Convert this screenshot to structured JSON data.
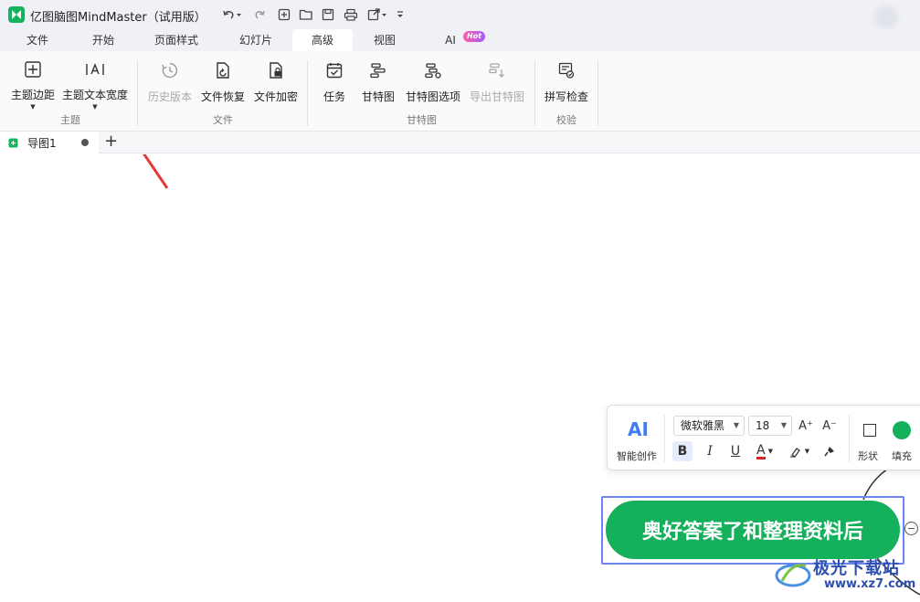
{
  "app": {
    "title": "亿图脑图MindMaster（试用版）",
    "brand_color": "#16b35f"
  },
  "quick_access": {
    "icons": [
      "undo-icon",
      "redo-icon",
      "new-icon",
      "open-folder-icon",
      "save-icon",
      "print-icon",
      "export-icon",
      "customize-icon"
    ]
  },
  "menu": {
    "tabs": [
      "文件",
      "开始",
      "页面样式",
      "幻灯片",
      "高级",
      "视图",
      "AI"
    ],
    "active": "高级",
    "ai_badge": "Hot"
  },
  "ribbon": {
    "groups": {
      "topic": "主题",
      "file": "文件",
      "gantt": "甘特图",
      "check": "校验"
    },
    "buttons": {
      "topic_margin": "主题边距",
      "topic_text_width": "主题文本宽度",
      "history": "历史版本",
      "file_restore": "文件恢复",
      "file_encrypt": "文件加密",
      "task": "任务",
      "gantt": "甘特图",
      "gantt_options": "甘特图选项",
      "export_gantt": "导出甘特图",
      "spell_check": "拼写检查"
    }
  },
  "document_tabs": {
    "current": "导图1",
    "add": "+"
  },
  "float_toolbar": {
    "ai_icon": "AI",
    "ai_label": "智能创作",
    "font_family": "微软雅黑",
    "font_size": "18",
    "increase_font": "A⁺",
    "decrease_font": "A⁻",
    "bold": "B",
    "italic": "I",
    "underline": "U",
    "font_color_letter": "A",
    "font_color": "#e02020",
    "shape_label": "形状",
    "fill_label": "填充",
    "fill_color": "#14b05c"
  },
  "topic": {
    "text": "奥好答案了和整理资料后",
    "color": "#14b05c"
  },
  "watermark": {
    "text": "极光下载站",
    "url": "www.xz7.com"
  }
}
